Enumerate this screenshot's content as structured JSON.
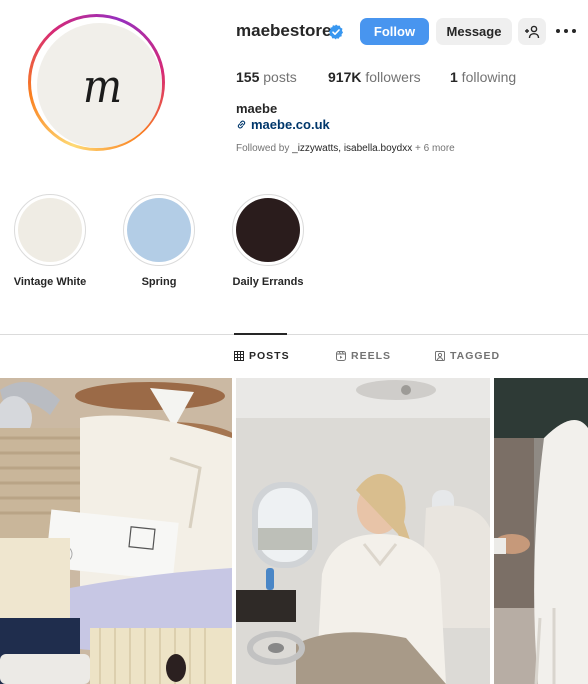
{
  "profile": {
    "username": "maebestore",
    "verified": true,
    "avatar_logo_text": "m",
    "display_name": "maebe",
    "link": "maebe.co.uk",
    "followed_by_prefix": "Followed by ",
    "followed_by_names": "_izzywatts, isabella.boydxx",
    "followed_by_suffix": " + 6 more"
  },
  "actions": {
    "follow_label": "Follow",
    "message_label": "Message"
  },
  "stats": {
    "posts_count": "155",
    "posts_label": " posts",
    "followers_count": "917K",
    "followers_label": " followers",
    "following_count": "1",
    "following_label": " following"
  },
  "highlights": [
    {
      "label": "Vintage White",
      "color": "#efece4"
    },
    {
      "label": "Spring",
      "color": "#b3cde6"
    },
    {
      "label": "Daily Errands",
      "color": "#2a1c1c"
    }
  ],
  "tabs": [
    {
      "label": "POSTS",
      "icon": "grid-icon",
      "active": true
    },
    {
      "label": "REELS",
      "icon": "reels-icon",
      "active": false
    },
    {
      "label": "TAGGED",
      "icon": "tagged-icon",
      "active": false
    }
  ],
  "colors": {
    "follow_button": "#4895ef",
    "verified_badge": "#3897f0",
    "link": "#00376b"
  }
}
